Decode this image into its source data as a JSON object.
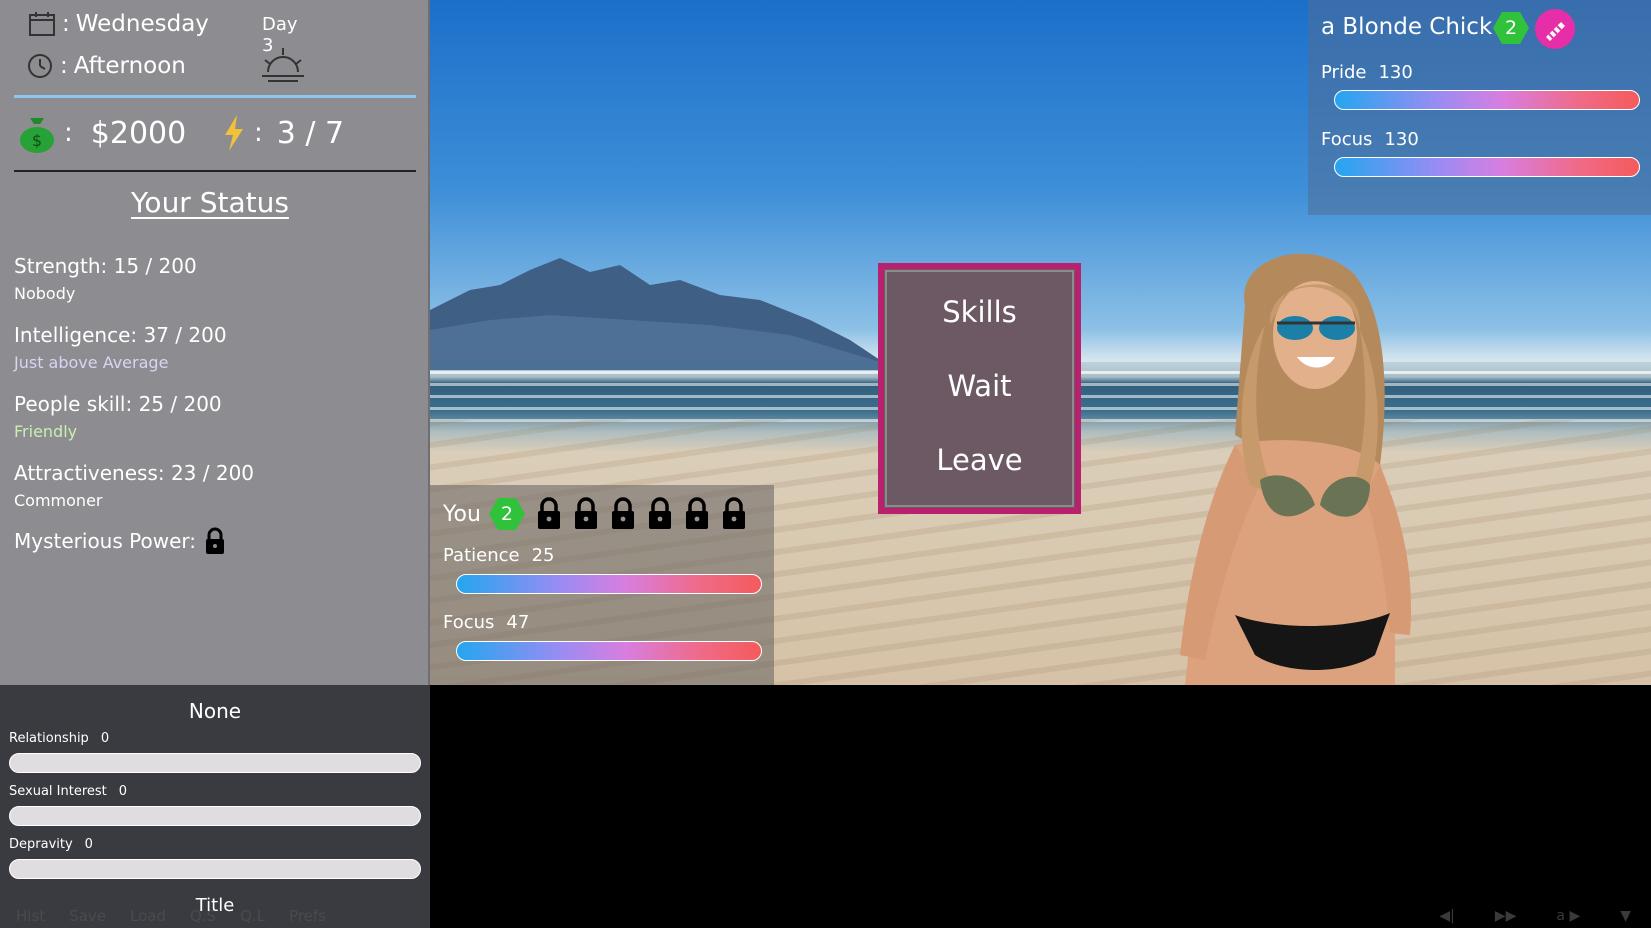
{
  "time": {
    "day_name": "Wednesday",
    "day_label": "Day 3",
    "time_of_day": "Afternoon"
  },
  "resources": {
    "money_sep": ":",
    "money": "$2000",
    "energy_sep": ":",
    "energy": "3 / 7"
  },
  "status": {
    "title": "Your Status",
    "stats": [
      {
        "line": "Strength: 15 / 200",
        "rank": "Nobody",
        "rank_color": "#ffffff"
      },
      {
        "line": "Intelligence: 37 / 200",
        "rank": "Just above Average",
        "rank_color": "#d8d4f4"
      },
      {
        "line": "People skill: 25 / 200",
        "rank": "Friendly",
        "rank_color": "#c8f0b0"
      },
      {
        "line": "Attractiveness: 23 / 200",
        "rank": "Commoner",
        "rank_color": "#ffffff"
      }
    ],
    "mysterious_label": "Mysterious Power:"
  },
  "relationship": {
    "name": "None",
    "rows": [
      {
        "label": "Relationship",
        "value": "0"
      },
      {
        "label": "Sexual Interest",
        "value": "0"
      },
      {
        "label": "Depravity",
        "value": "0"
      }
    ]
  },
  "quick_menu": {
    "title": "Title",
    "items": [
      "Hist",
      "Save",
      "Load",
      "Q.S",
      "Q.L",
      "Prefs"
    ]
  },
  "player": {
    "label": "You",
    "level": "2",
    "bars": [
      {
        "label": "Patience",
        "value": "25",
        "fill": 1.0
      },
      {
        "label": "Focus",
        "value": "47",
        "fill": 1.0
      }
    ]
  },
  "npc": {
    "name": "a Blonde Chick",
    "level": "2",
    "bars": [
      {
        "label": "Pride",
        "value": "130",
        "fill": 1.0
      },
      {
        "label": "Focus",
        "value": "130",
        "fill": 1.0
      }
    ]
  },
  "menu": {
    "items": [
      "Skills",
      "Wait",
      "Leave"
    ]
  },
  "dialog_controls": [
    "◀|",
    "▶▶",
    "a ▶",
    "▼"
  ],
  "colors": {
    "accent_pink": "#b8216e",
    "hex_green": "#2fc23a",
    "badge_pink": "#e62ea8"
  }
}
